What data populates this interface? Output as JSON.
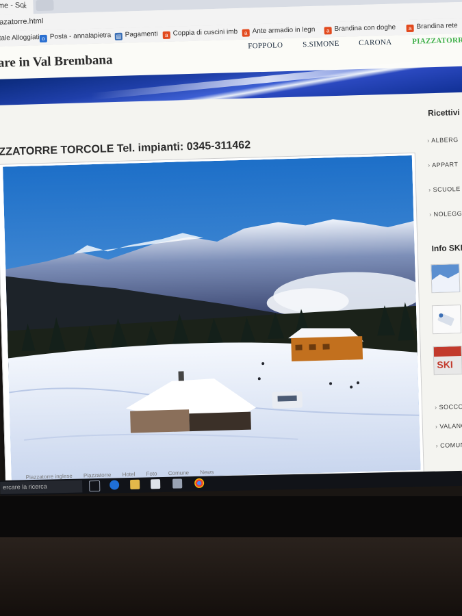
{
  "browser": {
    "tab_title": "ime - Sci",
    "tab_close": "×",
    "url": "azatorre.html",
    "bookmarks": [
      {
        "label": "ortale Alloggiati",
        "icon": "none"
      },
      {
        "label": "Posta - annalapietra",
        "icon": "outlook-icon"
      },
      {
        "label": "Pagamenti",
        "icon": "document-icon"
      },
      {
        "label": "Coppia di cuscini imb",
        "icon": "shop-icon"
      },
      {
        "label": "Ante armadio in legn",
        "icon": "shop-icon"
      },
      {
        "label": "Brandina con doghe",
        "icon": "shop-icon"
      },
      {
        "label": "Brandina rete",
        "icon": "shop-icon"
      }
    ]
  },
  "site": {
    "title": "are in Val Brembana",
    "nav": [
      "FOPPOLO",
      "S.SIMONE",
      "CARONA",
      "PIAZZATORRE"
    ],
    "active_nav": "PIAZZATORRE"
  },
  "main": {
    "heading": "ZZATORRE TORCOLE Tel. impianti: 0345-311462"
  },
  "sidebar": {
    "head1": "Ricettivi",
    "items1": [
      "ALBERG",
      "APPART",
      "SCUOLE",
      "NOLEGG"
    ],
    "head2": "Info SKI",
    "items2": [
      "SOCCORS",
      "VALANGH",
      "COMUNI"
    ],
    "thumb3_label": "SKI"
  },
  "footer_tabs": [
    "Piazzatorre inglese",
    "Piazzatorre",
    "Hotel",
    "Foto",
    "Comune",
    "News"
  ],
  "taskbar": {
    "search_placeholder": "ercare la ricerca"
  },
  "colors": {
    "nav_active": "#3fb04a",
    "banner": "#1f3faa",
    "sky": "#3a8fd8"
  }
}
